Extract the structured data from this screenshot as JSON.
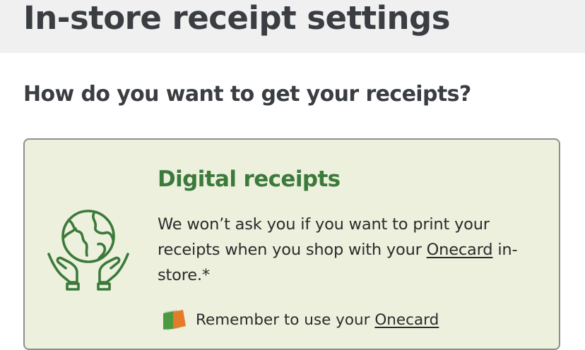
{
  "header": {
    "title": "In-store receipt settings"
  },
  "main": {
    "question": "How do you want to get your receipts?",
    "option": {
      "icon": "globe-in-hands-icon",
      "title": "Digital receipts",
      "body_before_link": "We won’t ask you if you want to print your receipts when you shop with your ",
      "body_link": "Onecard",
      "body_after_link": " in-store.*",
      "reminder_icon": "onecard-icon",
      "reminder_text": "Remember to use your ",
      "reminder_link": "Onecard"
    }
  },
  "colors": {
    "title_text": "#3a3d41",
    "accent_green": "#3b7a3b",
    "card_background": "#edf0dd",
    "card_border": "#8b8e8f",
    "onecard_green": "#4a9a3f",
    "onecard_orange": "#e57a2a"
  }
}
